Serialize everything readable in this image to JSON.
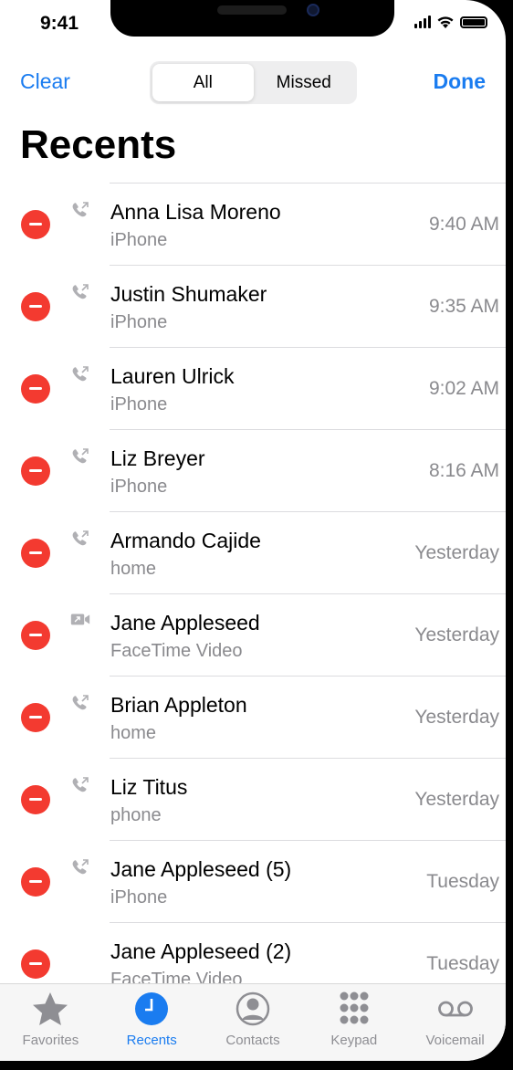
{
  "status_bar": {
    "time": "9:41"
  },
  "nav": {
    "clear_label": "Clear",
    "done_label": "Done",
    "segments": [
      "All",
      "Missed"
    ],
    "selected_segment": "All"
  },
  "title": "Recents",
  "calls": [
    {
      "name": "Anna Lisa Moreno",
      "type": "iPhone",
      "when": "9:40 AM",
      "icon": "phone-outgoing-icon"
    },
    {
      "name": "Justin Shumaker",
      "type": "iPhone",
      "when": "9:35 AM",
      "icon": "phone-outgoing-icon"
    },
    {
      "name": "Lauren Ulrick",
      "type": "iPhone",
      "when": "9:02 AM",
      "icon": "phone-outgoing-icon"
    },
    {
      "name": "Liz Breyer",
      "type": "iPhone",
      "when": "8:16 AM",
      "icon": "phone-outgoing-icon"
    },
    {
      "name": "Armando Cajide",
      "type": "home",
      "when": "Yesterday",
      "icon": "phone-outgoing-icon"
    },
    {
      "name": "Jane Appleseed",
      "type": "FaceTime Video",
      "when": "Yesterday",
      "icon": "video-outgoing-icon"
    },
    {
      "name": "Brian Appleton",
      "type": "home",
      "when": "Yesterday",
      "icon": "phone-outgoing-icon"
    },
    {
      "name": "Liz Titus",
      "type": "phone",
      "when": "Yesterday",
      "icon": "phone-outgoing-icon"
    },
    {
      "name": "Jane Appleseed (5)",
      "type": "iPhone",
      "when": "Tuesday",
      "icon": "phone-outgoing-icon"
    },
    {
      "name": "Jane Appleseed (2)",
      "type": "FaceTime Video",
      "when": "Tuesday",
      "icon": ""
    }
  ],
  "tabs": [
    {
      "label": "Favorites",
      "icon": "star-icon"
    },
    {
      "label": "Recents",
      "icon": "clock-icon",
      "active": true
    },
    {
      "label": "Contacts",
      "icon": "person-circle-icon"
    },
    {
      "label": "Keypad",
      "icon": "keypad-icon"
    },
    {
      "label": "Voicemail",
      "icon": "voicemail-icon"
    }
  ],
  "colors": {
    "accent": "#1a7cf0",
    "delete": "#f33a30",
    "secondary_text": "#8a8a8e"
  }
}
